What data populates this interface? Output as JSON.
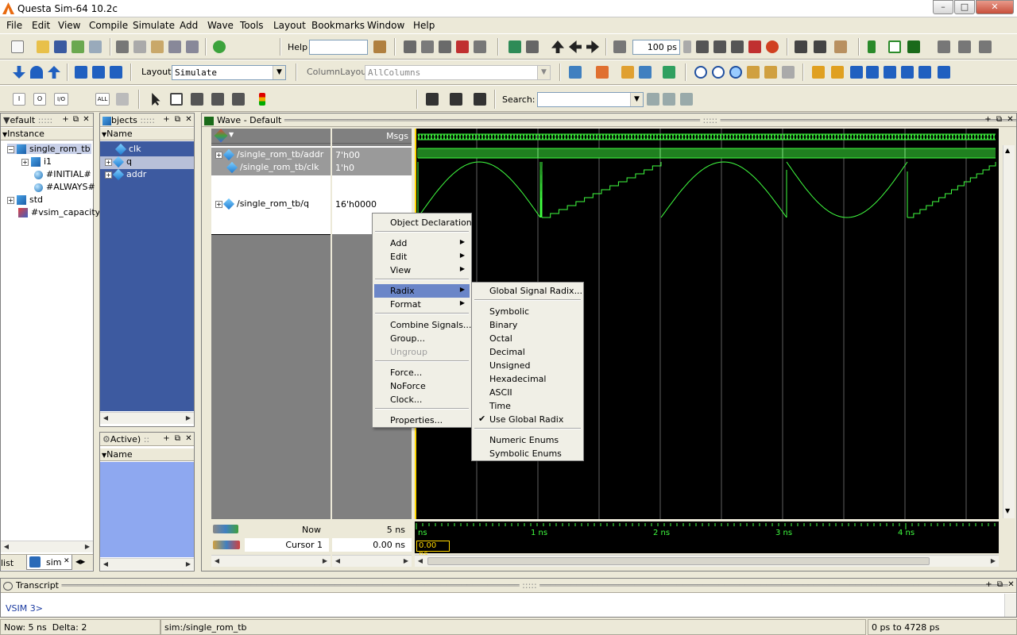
{
  "window": {
    "title": "Questa Sim-64 10.2c",
    "min": "–",
    "max": "□",
    "close": "✕"
  },
  "menubar": [
    "File",
    "Edit",
    "View",
    "Compile",
    "Simulate",
    "Add",
    "Wave",
    "Tools",
    "Layout",
    "Bookmarks",
    "Window",
    "Help"
  ],
  "toolbar1": {
    "help_label": "Help",
    "help_value": "",
    "run_length": "100 ps"
  },
  "toolbar2": {
    "layout_label": "Layout",
    "layout_value": "Simulate",
    "columnlayout_label": "ColumnLayout",
    "columnlayout_value": "AllColumns"
  },
  "toolbar3": {
    "search_label": "Search:",
    "search_value": "",
    "tools": [
      "I",
      "O",
      "I/O",
      "ALL"
    ]
  },
  "structure_panel": {
    "title": "efault",
    "column": "Instance",
    "items": [
      {
        "label": "single_rom_tb",
        "icon": "instance-icon",
        "expanded": true,
        "selected": true
      },
      {
        "label": "i1",
        "icon": "instance-icon"
      },
      {
        "label": "#INITIAL#",
        "icon": "process-icon"
      },
      {
        "label": "#ALWAYS#",
        "icon": "process-icon"
      },
      {
        "label": "std",
        "icon": "instance-icon"
      },
      {
        "label": "#vsim_capacity",
        "icon": "capacity-icon"
      }
    ],
    "tabs": [
      {
        "label": "list"
      },
      {
        "label": "sim"
      }
    ]
  },
  "objects_panel": {
    "title": "bjects",
    "column": "Name",
    "items": [
      {
        "label": "clk"
      },
      {
        "label": "q"
      },
      {
        "label": "addr"
      }
    ]
  },
  "processes_panel": {
    "title": "Active)",
    "column": "Name"
  },
  "wave": {
    "title": "Wave - Default",
    "msgs_header": "Msgs",
    "signals": [
      {
        "name": "/single_rom_tb/addr",
        "value": "7'h00"
      },
      {
        "name": "/single_rom_tb/clk",
        "value": "1'h0"
      },
      {
        "name": "/single_rom_tb/q",
        "value": "16'h0000"
      }
    ],
    "now_label": "Now",
    "now_value": "5 ns",
    "cursor_label": "Cursor 1",
    "cursor_value": "0.00 ns",
    "cursor_tag": "0.00 ns",
    "time_ticks": [
      "ns",
      "1 ns",
      "2 ns",
      "3 ns",
      "4 ns"
    ],
    "colors": {
      "background": "#000000",
      "trace": "#40ff40",
      "cursor": "#ffd700"
    }
  },
  "context_menu": {
    "items": [
      {
        "label": "Object Declaration"
      },
      {
        "label": "Add",
        "submenu": true
      },
      {
        "label": "Edit",
        "submenu": true
      },
      {
        "label": "View",
        "submenu": true
      },
      {
        "label": "Radix",
        "submenu": true,
        "selected": true
      },
      {
        "label": "Format",
        "submenu": true
      },
      {
        "label": "Combine Signals..."
      },
      {
        "label": "Group..."
      },
      {
        "label": "Ungroup",
        "disabled": true
      },
      {
        "label": "Force..."
      },
      {
        "label": "NoForce"
      },
      {
        "label": "Clock..."
      },
      {
        "label": "Properties..."
      }
    ]
  },
  "radix_submenu": {
    "items": [
      {
        "label": "Global Signal Radix..."
      },
      {
        "label": "Symbolic"
      },
      {
        "label": "Binary"
      },
      {
        "label": "Octal"
      },
      {
        "label": "Decimal"
      },
      {
        "label": "Unsigned"
      },
      {
        "label": "Hexadecimal"
      },
      {
        "label": "ASCII"
      },
      {
        "label": "Time"
      },
      {
        "label": "Use Global Radix",
        "checked": true
      },
      {
        "label": "Numeric Enums"
      },
      {
        "label": "Symbolic Enums"
      }
    ]
  },
  "transcript": {
    "title": "Transcript",
    "prompt": "VSIM 3>"
  },
  "status": {
    "now": "Now: 5 ns",
    "delta": "Delta: 2",
    "context": "sim:/single_rom_tb",
    "range": "0 ps to 4728 ps"
  }
}
